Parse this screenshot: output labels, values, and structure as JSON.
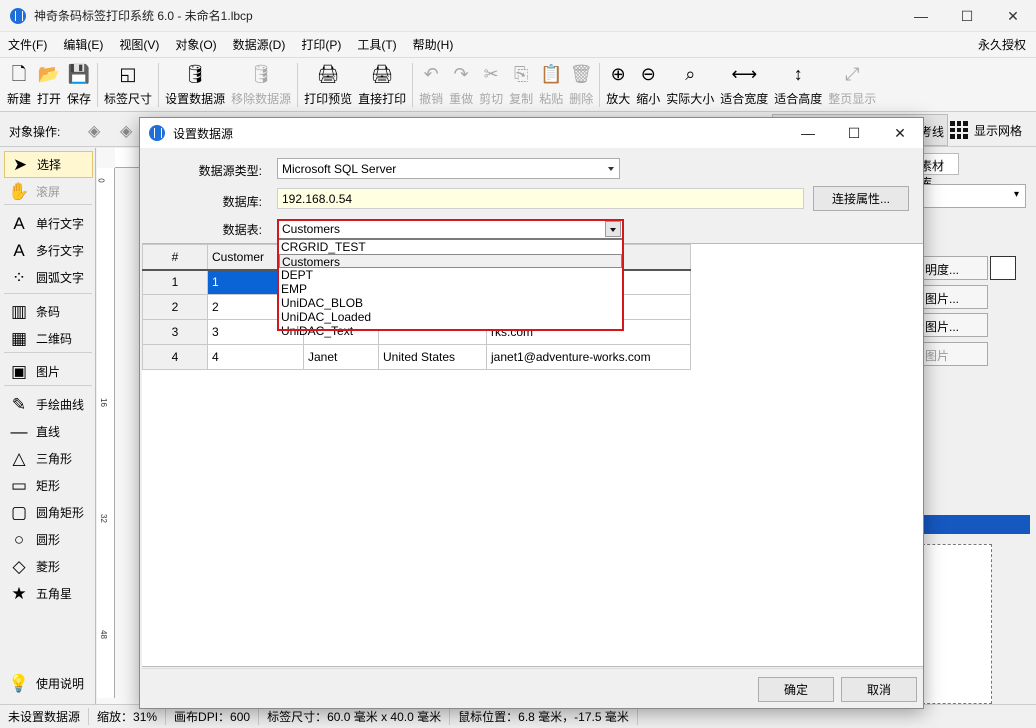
{
  "window": {
    "title": "神奇条码标签打印系统 6.0 - 未命名1.lbcp",
    "minimize": "—",
    "maximize": "☐",
    "close": "✕"
  },
  "menu": {
    "items": [
      "文件(F)",
      "编辑(E)",
      "视图(V)",
      "对象(O)",
      "数据源(D)",
      "打印(P)",
      "工具(T)",
      "帮助(H)"
    ],
    "license": "永久授权"
  },
  "toolbar": {
    "items": [
      {
        "label": "新建",
        "icon": "new-file-icon",
        "glyph": "🗋",
        "enabled": true
      },
      {
        "label": "打开",
        "icon": "open-icon",
        "glyph": "📂",
        "enabled": true
      },
      {
        "label": "保存",
        "icon": "save-icon",
        "glyph": "💾",
        "enabled": true
      },
      {
        "label": "标签尺寸",
        "icon": "label-size-icon",
        "glyph": "◱",
        "enabled": true
      },
      {
        "label": "设置数据源",
        "icon": "database-settings-icon",
        "glyph": "🛢",
        "enabled": true
      },
      {
        "label": "移除数据源",
        "icon": "remove-database-icon",
        "glyph": "🛢",
        "enabled": false
      },
      {
        "label": "打印预览",
        "icon": "print-preview-icon",
        "glyph": "🖨",
        "enabled": true
      },
      {
        "label": "直接打印",
        "icon": "print-icon",
        "glyph": "🖨",
        "enabled": true
      },
      {
        "label": "撤销",
        "icon": "undo-icon",
        "glyph": "↶",
        "enabled": false
      },
      {
        "label": "重做",
        "icon": "redo-icon",
        "glyph": "↷",
        "enabled": false
      },
      {
        "label": "剪切",
        "icon": "cut-icon",
        "glyph": "✂",
        "enabled": false
      },
      {
        "label": "复制",
        "icon": "copy-icon",
        "glyph": "⎘",
        "enabled": false
      },
      {
        "label": "粘贴",
        "icon": "paste-icon",
        "glyph": "📋",
        "enabled": false
      },
      {
        "label": "删除",
        "icon": "delete-icon",
        "glyph": "🗑",
        "enabled": false
      },
      {
        "label": "放大",
        "icon": "zoom-in-icon",
        "glyph": "⊕",
        "enabled": true
      },
      {
        "label": "缩小",
        "icon": "zoom-out-icon",
        "glyph": "⊖",
        "enabled": true
      },
      {
        "label": "实际大小",
        "icon": "actual-size-icon",
        "glyph": "⌕",
        "enabled": true
      },
      {
        "label": "适合宽度",
        "icon": "fit-width-icon",
        "glyph": "⟷",
        "enabled": true
      },
      {
        "label": "适合高度",
        "icon": "fit-height-icon",
        "glyph": "↕",
        "enabled": true
      },
      {
        "label": "整页显示",
        "icon": "fit-page-icon",
        "glyph": "⤢",
        "enabled": false
      }
    ]
  },
  "objbar": {
    "label": "对象操作:",
    "ref_line": "考线",
    "show_grid": "显示网格"
  },
  "palette": {
    "items": [
      {
        "label": "选择",
        "icon": "pointer-icon",
        "glyph": "➤",
        "state": "selected"
      },
      {
        "label": "滚屏",
        "icon": "hand-icon",
        "glyph": "✋",
        "state": "disabled"
      },
      {
        "label": "单行文字",
        "icon": "single-line-text-icon",
        "glyph": "A",
        "state": "normal"
      },
      {
        "label": "多行文字",
        "icon": "multi-line-text-icon",
        "glyph": "A",
        "state": "normal"
      },
      {
        "label": "圆弧文字",
        "icon": "arc-text-icon",
        "glyph": "⁘",
        "state": "normal"
      },
      {
        "label": "条码",
        "icon": "barcode-icon",
        "glyph": "▥",
        "state": "normal"
      },
      {
        "label": "二维码",
        "icon": "qrcode-icon",
        "glyph": "▦",
        "state": "normal"
      },
      {
        "label": "图片",
        "icon": "image-icon",
        "glyph": "▣",
        "state": "normal"
      },
      {
        "label": "手绘曲线",
        "icon": "freehand-icon",
        "glyph": "✎",
        "state": "normal"
      },
      {
        "label": "直线",
        "icon": "line-icon",
        "glyph": "—",
        "state": "normal"
      },
      {
        "label": "三角形",
        "icon": "triangle-icon",
        "glyph": "△",
        "state": "normal"
      },
      {
        "label": "矩形",
        "icon": "rectangle-icon",
        "glyph": "▭",
        "state": "normal"
      },
      {
        "label": "圆角矩形",
        "icon": "rounded-rectangle-icon",
        "glyph": "▢",
        "state": "normal"
      },
      {
        "label": "圆形",
        "icon": "circle-icon",
        "glyph": "○",
        "state": "normal"
      },
      {
        "label": "菱形",
        "icon": "diamond-icon",
        "glyph": "◇",
        "state": "normal"
      },
      {
        "label": "五角星",
        "icon": "star-icon",
        "glyph": "★",
        "state": "normal"
      },
      {
        "label": "使用说明",
        "icon": "lightbulb-icon",
        "glyph": "💡",
        "state": "normal"
      }
    ]
  },
  "ruler": {
    "v": [
      "0",
      "16",
      "32",
      "48"
    ]
  },
  "right_panel": {
    "tab": "素材库",
    "buttons": [
      "明度...",
      "图片...",
      "图片...",
      "图片"
    ]
  },
  "statusbar": {
    "items": [
      "未设置数据源",
      "缩放：31%",
      "画布DPI：600",
      "标签尺寸：60.0 毫米 x 40.0 毫米",
      "鼠标位置：6.8 毫米，-17.5 毫米"
    ]
  },
  "dialog": {
    "title": "设置数据源",
    "source_type_label": "数据源类型:",
    "source_type_value": "Microsoft SQL Server",
    "database_label": "数据库:",
    "database_value": "192.168.0.54",
    "connect_button": "连接属性...",
    "table_label": "数据表:",
    "table_value": "Customers",
    "table_options": [
      "CRGRID_TEST",
      "Customers",
      "DEPT",
      "EMP",
      "UniDAC_BLOB",
      "UniDAC_Loaded",
      "UniDAC_Text"
    ],
    "grid": {
      "headers": [
        "#",
        "Customer",
        "",
        "",
        ""
      ],
      "rows": [
        [
          "1",
          "1",
          "",
          "",
          ""
        ],
        [
          "2",
          "2",
          "",
          "",
          "rks.com"
        ],
        [
          "3",
          "3",
          "",
          "",
          "rks.com"
        ],
        [
          "4",
          "4",
          "Janet",
          "United States",
          "janet1@adventure-works.com"
        ]
      ]
    },
    "ok_button": "确定",
    "cancel_button": "取消"
  }
}
